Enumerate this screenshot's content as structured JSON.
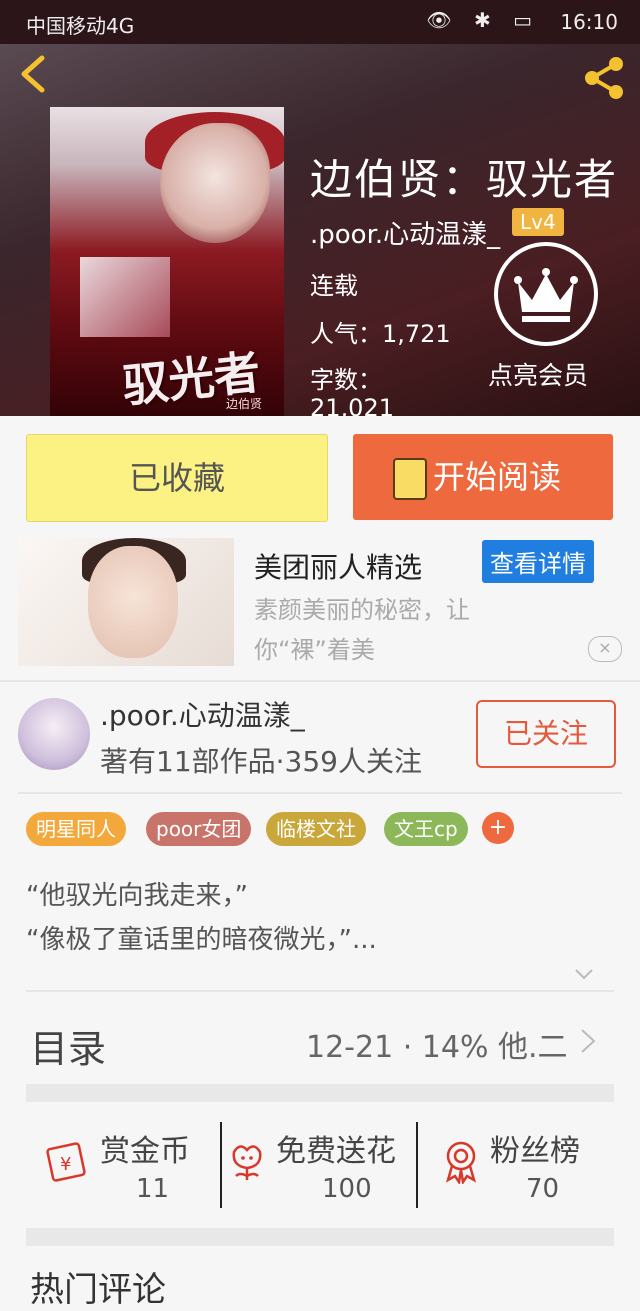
{
  "status_bar": {
    "carrier": "中国移动4G",
    "time": "16:10"
  },
  "book": {
    "title": "边伯贤：驭光者",
    "author": ".poor.心动温漾_",
    "level": "Lv4",
    "status": "连载",
    "popularity": "人气：1,721",
    "wordcount_label": "字数：",
    "wordcount_value": "21,021",
    "vip_label": "点亮会员",
    "cover_title": "驭光者",
    "cover_sub": "边伯贤"
  },
  "actions": {
    "collected_label": "已收藏",
    "read_label": "开始阅读"
  },
  "ad": {
    "title": "美团丽人精选",
    "detail_label": "查看详情",
    "description": "素颜美丽的秘密，让你“裸”着美",
    "close": "×"
  },
  "author_card": {
    "name": ".poor.心动温漾_",
    "stats": "著有11部作品·359人关注",
    "follow_label": "已关注"
  },
  "tags": [
    "明星同人",
    "poor女团",
    "临楼文社",
    "文王cp"
  ],
  "tag_add": "+",
  "quote_lines": [
    "“他驭光向我走来，”",
    "“像极了童话里的暗夜微光，”..."
  ],
  "toc": {
    "label": "目录",
    "latest": "12-21 · 14% 他.二"
  },
  "stats": [
    {
      "label": "赏金币",
      "value": "11",
      "icon": "gold-coin-icon"
    },
    {
      "label": "免费送花",
      "value": "100",
      "icon": "flower-icon"
    },
    {
      "label": "粉丝榜",
      "value": "70",
      "icon": "medal-icon"
    }
  ],
  "next_section": "热门评论",
  "colors": {
    "accent_orange": "#ee6a3e",
    "collect_yellow": "#fbf283",
    "link_blue": "#1f7ee0"
  }
}
